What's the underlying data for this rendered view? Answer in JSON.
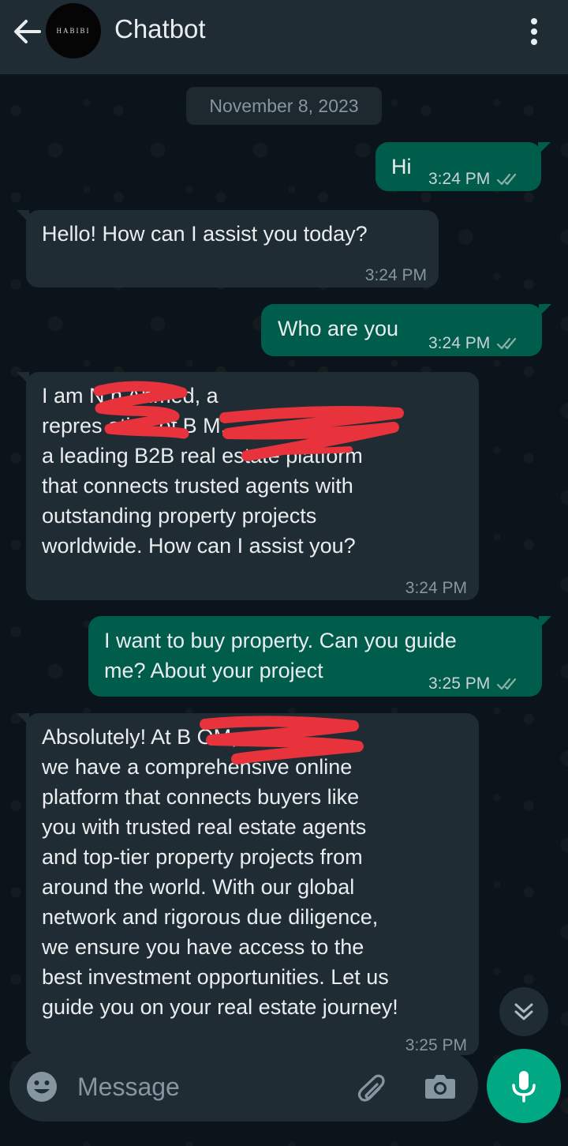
{
  "header": {
    "title": "Chatbot",
    "avatar_text": "HABIBI"
  },
  "date_chip": "November 8, 2023",
  "messages": [
    {
      "dir": "out",
      "lines": [
        "Hi"
      ],
      "time": "3:24 PM"
    },
    {
      "dir": "in",
      "lines": [
        "Hello! How can I assist you today?"
      ],
      "time": "3:24 PM"
    },
    {
      "dir": "out",
      "lines": [
        "Who are you"
      ],
      "time": "3:24 PM"
    },
    {
      "dir": "in",
      "lines": [
        "I am N      n Ahmed, a",
        "repres     ative of B              M,",
        "a leading B2B real estate platform",
        "that connects trusted agents with",
        "outstanding property projects",
        "worldwide. How can I assist you?"
      ],
      "time": "3:24 PM"
    },
    {
      "dir": "out",
      "lines": [
        "I want to buy property. Can you guide",
        "me? About your project"
      ],
      "time": "3:25 PM"
    },
    {
      "dir": "in",
      "lines": [
        "Absolutely! At B              OM,",
        "we have a comprehensive online",
        "platform that connects buyers like",
        "you with trusted real estate agents",
        "and top-tier property projects from",
        "around the world. With our global",
        "network and rigorous due diligence,",
        "we ensure you have access to the",
        "best investment opportunities. Let us",
        "guide you on your real estate journey!"
      ],
      "time": "3:25 PM"
    }
  ],
  "input": {
    "placeholder": "Message"
  },
  "colors": {
    "background": "#0b141a",
    "header": "#1f2c34",
    "outgoing_bubble": "#005c4b",
    "incoming_bubble": "#202c33",
    "accent": "#00a884",
    "tick": "#8ab0a6",
    "redaction": "#e8323c"
  },
  "icons": [
    "back-arrow-icon",
    "more-vert-icon",
    "double-check-icon",
    "chevron-double-down-icon",
    "emoji-icon",
    "attach-icon",
    "camera-icon",
    "mic-icon"
  ]
}
